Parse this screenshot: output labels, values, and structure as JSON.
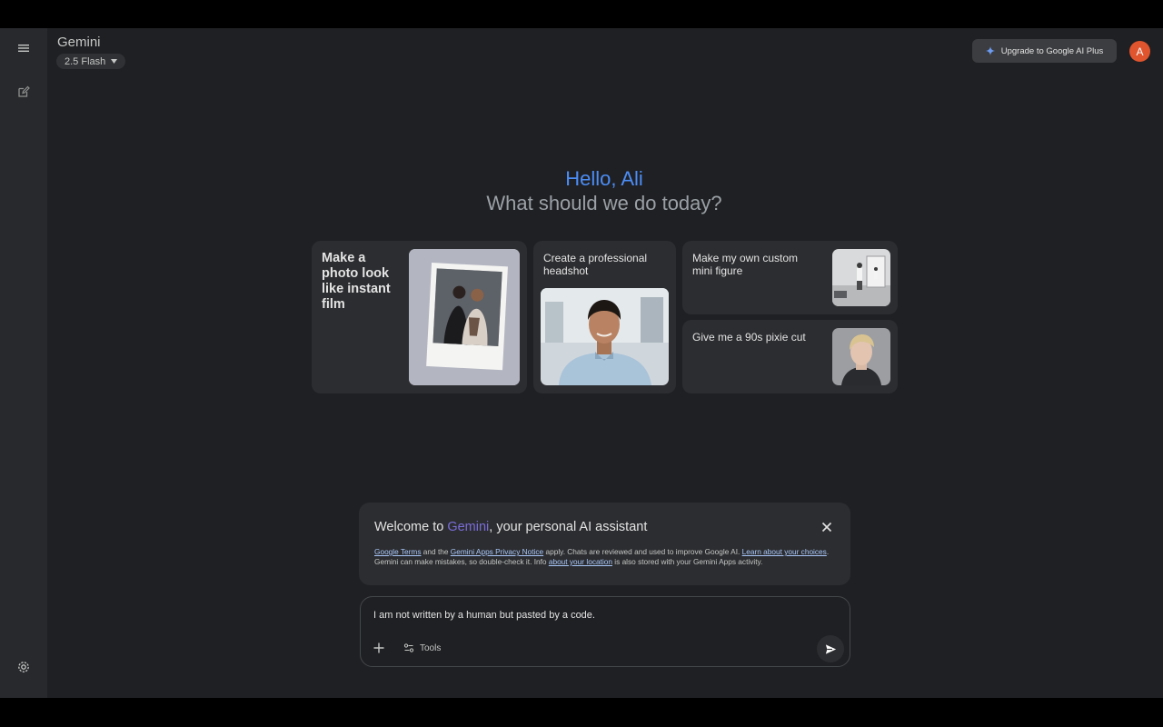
{
  "header": {
    "app_name": "Gemini",
    "model_label": "2.5 Flash",
    "upgrade_label": "Upgrade to Google AI Plus",
    "avatar_letter": "A"
  },
  "greeting": {
    "hello": "Hello, Ali",
    "subtitle": "What should we do today?"
  },
  "cards": [
    {
      "label": "Make a photo look like instant film",
      "thumb_icon": "polaroid-photo-icon"
    },
    {
      "label": "Create a professional headshot",
      "thumb_icon": "headshot-photo-icon"
    },
    {
      "label": "Make my own custom mini figure",
      "thumb_icon": "mini-figure-photo-icon"
    },
    {
      "label": "Give me a 90s pixie cut",
      "thumb_icon": "pixie-cut-photo-icon"
    }
  ],
  "notice": {
    "title_prefix": "Welcome to ",
    "title_brand": "Gemini",
    "title_suffix": ", your personal AI assistant",
    "link_terms": "Google Terms",
    "text_1": " and the ",
    "link_privacy": "Gemini Apps Privacy Notice",
    "text_2": " apply. Chats are reviewed and used to improve Google AI. ",
    "link_choices": "Learn about your choices",
    "text_3": ". Gemini can make mistakes, so double-check it. Info ",
    "link_location": "about your location",
    "text_4": " is also stored with your Gemini Apps activity."
  },
  "composer": {
    "value": "I am not written by a human but pasted by a code.",
    "tools_label": "Tools"
  },
  "colors": {
    "background": "#1f2023",
    "sidebar": "#28292c",
    "card": "#2c2d30",
    "accent_blue": "#4c8df6",
    "avatar": "#e0542e"
  }
}
